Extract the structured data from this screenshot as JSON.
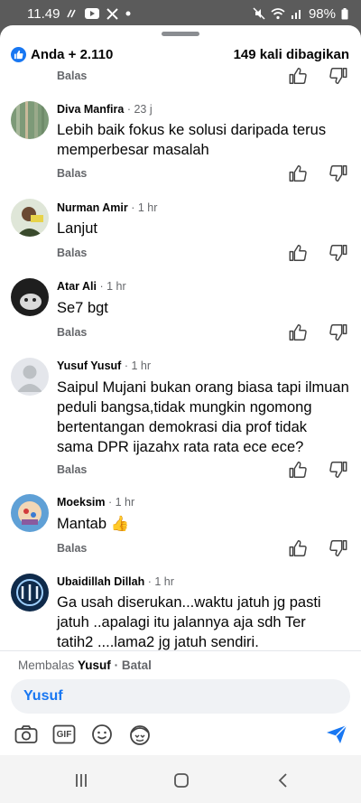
{
  "status_bar": {
    "time": "11.49",
    "battery": "98%"
  },
  "reactions": {
    "summary": "Anda + 2.110",
    "shares": "149 kali dibagikan"
  },
  "reply_label": "Balas",
  "comments": [
    {
      "name": "Diva Manfira",
      "time": "· 23 j",
      "text_lines": [
        "Lebih baik fokus ke solusi daripada terus",
        "memperbesar masalah"
      ]
    },
    {
      "name": "Nurman Amir",
      "time": "· 1 hr",
      "text_lines": [
        "Lanjut"
      ]
    },
    {
      "name": "Atar Ali",
      "time": "· 1 hr",
      "text_lines": [
        "Se7 bgt"
      ]
    },
    {
      "name": "Yusuf Yusuf",
      "time": "· 1 hr",
      "text_lines": [
        "Saipul Mujani bukan orang biasa tapi ilmuan",
        "peduli bangsa,tidak mungkin  ngomong",
        "bertentangan demokrasi dia prof tidak",
        "sama DPR ijazahx rata rata ece ece?"
      ]
    },
    {
      "name": "Moeksim",
      "time": "· 1 hr",
      "text_lines": [
        "Mantab 👍"
      ]
    },
    {
      "name": "Ubaidillah Dillah",
      "time": "· 1 hr",
      "text_lines": [
        "Ga usah diserukan...waktu jatuh jg pasti",
        "jatuh ..apalagi itu jalannya aja sdh Ter",
        "tatih2 ....lama2 jg jatuh sendiri."
      ]
    }
  ],
  "composer": {
    "replying_prefix": "Membalas",
    "replying_to": "Yusuf",
    "cancel": "· Batal",
    "input_value": "Yusuf",
    "gif_label": "GIF"
  },
  "colors": {
    "accent": "#1877f2",
    "secondary_text": "#65676b"
  }
}
